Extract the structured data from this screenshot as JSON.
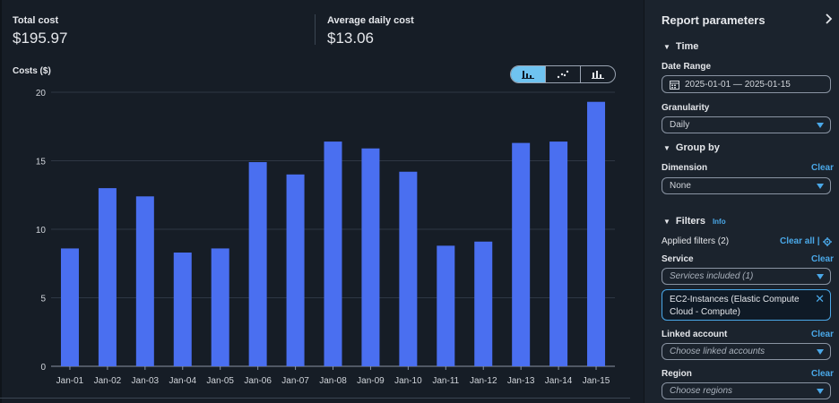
{
  "summary": {
    "total_label": "Total cost",
    "total_value": "$195.97",
    "avg_label": "Average daily cost",
    "avg_value": "$13.06"
  },
  "chart_toggle": {
    "options": [
      "bar-chart-icon",
      "scatter-chart-icon",
      "stacked-chart-icon"
    ],
    "active": "bar-chart-icon"
  },
  "chart_data": {
    "type": "bar",
    "ylabel": "Costs ($)",
    "categories": [
      "Jan-01",
      "Jan-02",
      "Jan-03",
      "Jan-04",
      "Jan-05",
      "Jan-06",
      "Jan-07",
      "Jan-08",
      "Jan-09",
      "Jan-10",
      "Jan-11",
      "Jan-12",
      "Jan-13",
      "Jan-14",
      "Jan-15"
    ],
    "values": [
      8.6,
      13.0,
      12.4,
      8.3,
      8.6,
      14.9,
      14.0,
      16.4,
      15.9,
      14.2,
      8.8,
      9.1,
      16.3,
      16.4,
      19.3
    ],
    "ylim": [
      0,
      20
    ],
    "yticks": [
      0,
      5,
      10,
      15,
      20
    ],
    "grid": true,
    "bar_color": "#4a6ff0"
  },
  "panel": {
    "title": "Report parameters",
    "time": {
      "section": "Time",
      "date_range_label": "Date Range",
      "date_range_value": "2025-01-01 — 2025-01-15",
      "granularity_label": "Granularity",
      "granularity_value": "Daily"
    },
    "group_by": {
      "section": "Group by",
      "dimension_label": "Dimension",
      "dimension_value": "None",
      "clear": "Clear"
    },
    "filters": {
      "section": "Filters",
      "info": "Info",
      "applied": "Applied filters (2)",
      "clear_all": "Clear all |",
      "service_label": "Service",
      "service_clear": "Clear",
      "service_value": "Services included (1)",
      "service_token": "EC2-Instances (Elastic Compute Cloud - Compute)",
      "linked_label": "Linked account",
      "linked_clear": "Clear",
      "linked_placeholder": "Choose linked accounts",
      "region_label": "Region",
      "region_clear": "Clear",
      "region_placeholder": "Choose regions"
    }
  },
  "colors": {
    "accent": "#4aa8e8",
    "background": "#161d26",
    "panel": "#1b232d"
  }
}
